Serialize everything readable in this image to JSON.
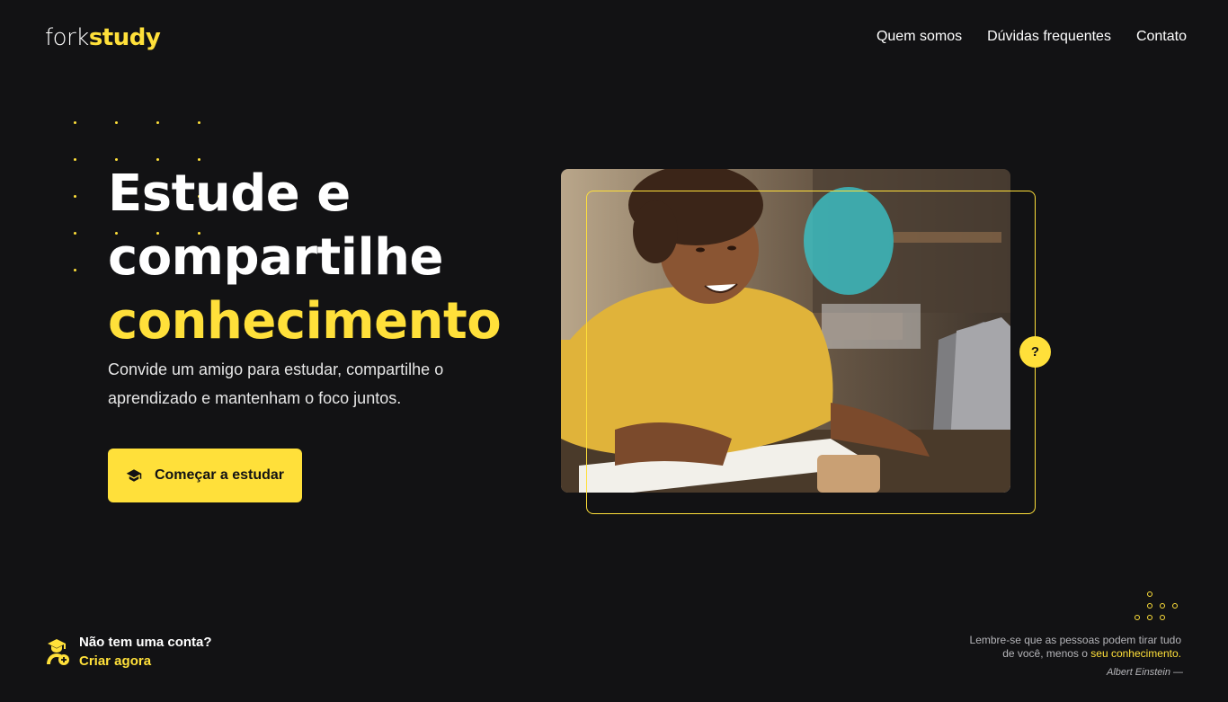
{
  "brand": {
    "logo_thin": "fork",
    "logo_bold": "study",
    "accent_color": "#FFE03A",
    "background_color": "#121214"
  },
  "nav": {
    "items": [
      "Quem somos",
      "Dúvidas frequentes",
      "Contato"
    ]
  },
  "hero": {
    "title_line1": "Estude e",
    "title_line2": "compartilhe",
    "title_line3": "conhecimento",
    "subtitle": "Convide um amigo para estudar, compartilhe o aprendizado e mantenham o foco juntos.",
    "cta_label": "Começar a estudar",
    "cta_icon": "graduation-cap-icon"
  },
  "photo": {
    "help_badge": "?"
  },
  "signup": {
    "question": "Não tem uma conta?",
    "link": "Criar agora",
    "icon": "student-add-icon"
  },
  "quote": {
    "text_before": "Lembre-se que as pessoas podem tirar tudo de você, menos o ",
    "highlight": "seu conhecimento.",
    "author": "Albert Einstein —"
  }
}
